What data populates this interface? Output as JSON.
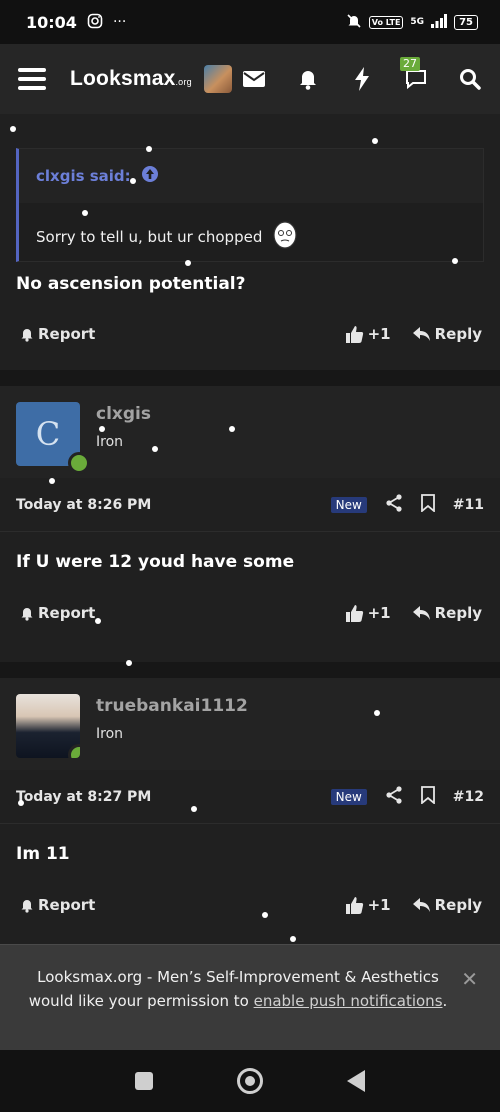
{
  "status_bar": {
    "time": "10:04",
    "network": "5G",
    "volte": "Vo LTE",
    "battery": "75"
  },
  "header": {
    "logo_main": "Looksmax",
    "logo_suffix": ".org",
    "chat_badge": "27"
  },
  "posts": [
    {
      "quote_author": "clxgis said:",
      "quote_text": "Sorry to tell u, but ur chopped",
      "text": "No ascension potential?",
      "report_label": "Report",
      "like_label": "+1",
      "reply_label": "Reply"
    },
    {
      "username": "clxgis",
      "avatar_letter": "C",
      "role": "Iron",
      "date": "Today at 8:26 PM",
      "new_badge": "New",
      "post_number": "#11",
      "text": "If U were 12 youd have some",
      "report_label": "Report",
      "like_label": "+1",
      "reply_label": "Reply"
    },
    {
      "username": "truebankai1112",
      "role": "Iron",
      "date": "Today at 8:27 PM",
      "new_badge": "New",
      "post_number": "#12",
      "text": "Im 11",
      "report_label": "Report",
      "like_label": "+1",
      "reply_label": "Reply"
    }
  ],
  "push_banner": {
    "text_before": "Looksmax.org - Men’s Self-Improvement & Aesthetics would like your permission to ",
    "link_text": "enable push notifications",
    "text_after": "."
  },
  "colors": {
    "accent_blue": "#5465c1",
    "online_green": "#6aab3a",
    "new_badge": "#273a7a"
  }
}
